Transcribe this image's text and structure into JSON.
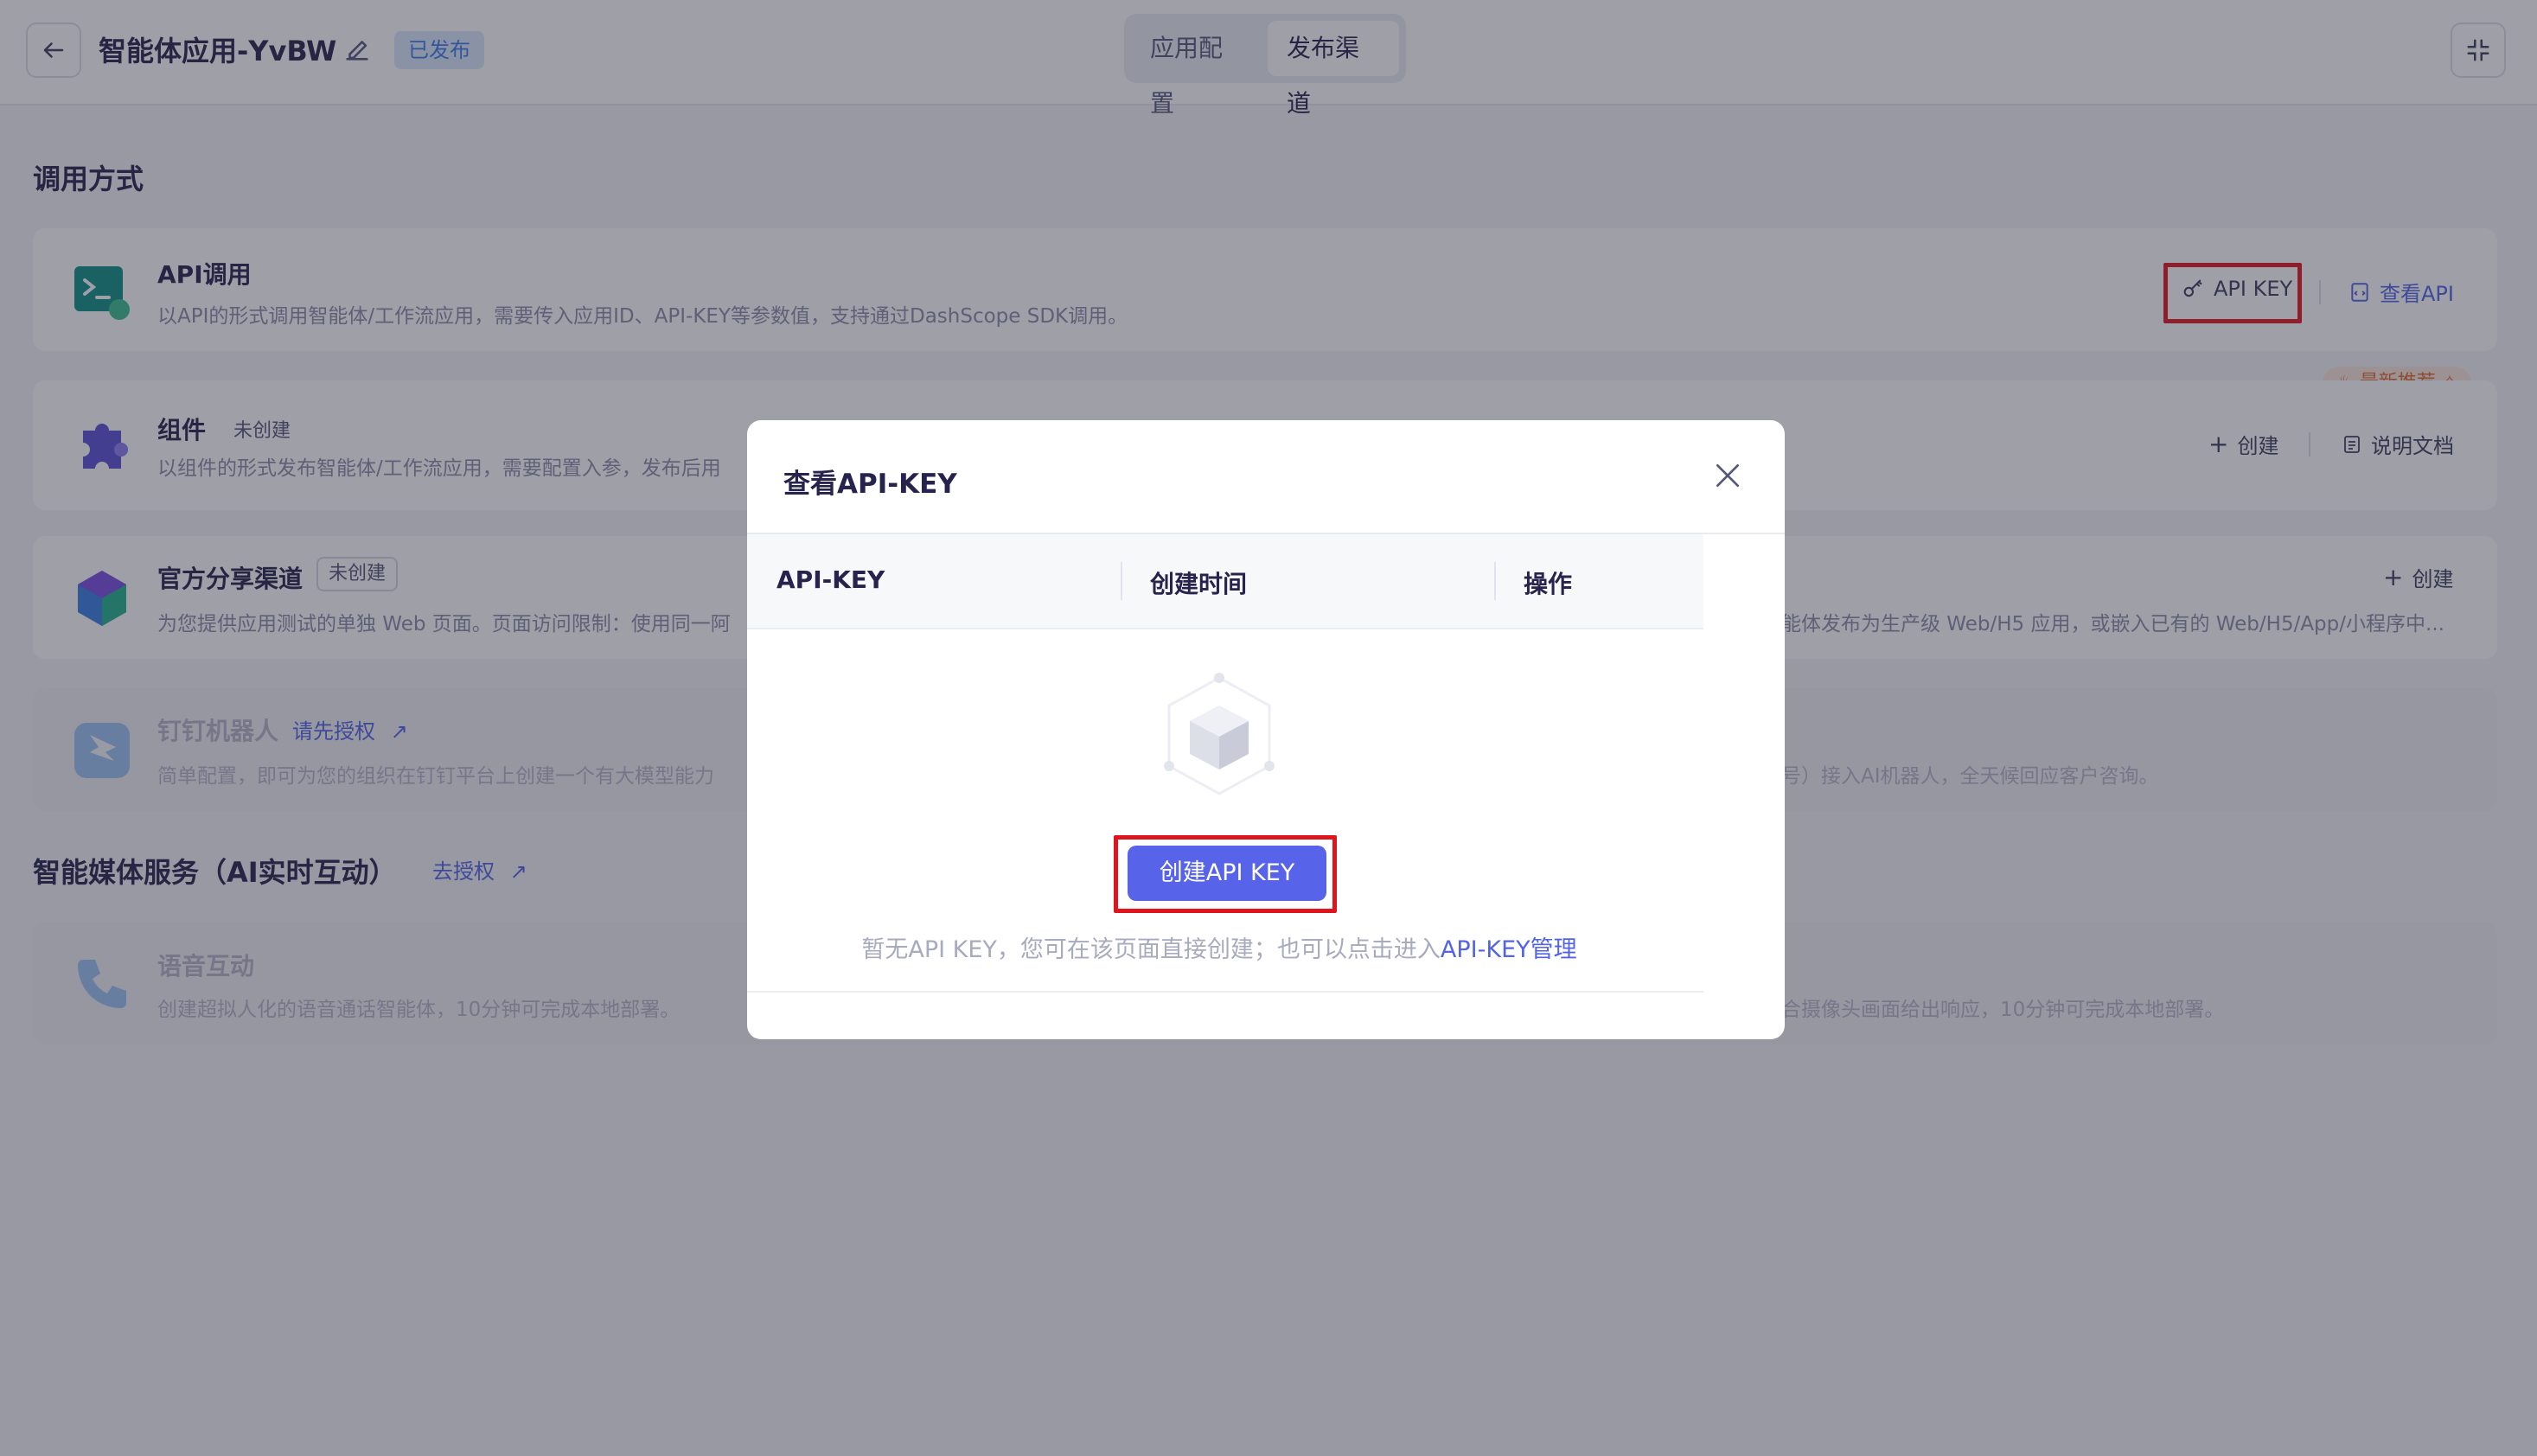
{
  "header": {
    "app_title": "智能体应用-YvBW",
    "status_badge": "已发布",
    "tabs": [
      {
        "label": "应用配置",
        "active": false
      },
      {
        "label": "发布渠道",
        "active": true
      }
    ]
  },
  "invoke_section": {
    "title": "调用方式",
    "api_card": {
      "title": "API调用",
      "desc": "以API的形式调用智能体/工作流应用，需要传入应用ID、API-KEY等参数值，支持通过DashScope SDK调用。",
      "api_key_label": "API KEY",
      "view_api_label": "查看API"
    },
    "component_card": {
      "title": "组件",
      "status": "未创建",
      "desc": "以组件的形式发布智能体/工作流应用，需要配置入参，发布后用",
      "recommend_label": "最新推荐",
      "create_label": "创建",
      "docs_label": "说明文档"
    },
    "share_card": {
      "title": "官方分享渠道",
      "status": "未创建",
      "desc_left": "为您提供应用测试的单独 Web 页面。页面访问限制：使用同一阿",
      "desc_right": "能体发布为生产级 Web/H5 应用，或嵌入已有的 Web/H5/App/小程序中...",
      "create_label": "创建"
    },
    "dingtalk_card": {
      "title": "钉钉机器人",
      "auth_link": "请先授权",
      "desc_left": "简单配置，即可为您的组织在钉钉平台上创建一个有大模型能力",
      "desc_right": "号）接入AI机器人，全天候回应客户咨询。"
    }
  },
  "media_section": {
    "title": "智能媒体服务（AI实时互动）",
    "auth_link": "去授权",
    "voice_card": {
      "title": "语音互动",
      "desc_left": "创建超拟人化的语音通话智能体，10分钟可完成本地部署。",
      "desc_right": "合摄像头画面给出响应，10分钟可完成本地部署。"
    }
  },
  "modal": {
    "title": "查看API-KEY",
    "columns": [
      "API-KEY",
      "创建时间",
      "操作"
    ],
    "create_button": "创建API KEY",
    "empty_text": "暂无API KEY，您可在该页面直接创建；也可以点击进入",
    "manage_link": "API-KEY管理"
  },
  "colors": {
    "accent": "#5763e8",
    "highlight": "#e0141c",
    "badge_bg": "#dbe8fb",
    "badge_text": "#3d7be8"
  }
}
